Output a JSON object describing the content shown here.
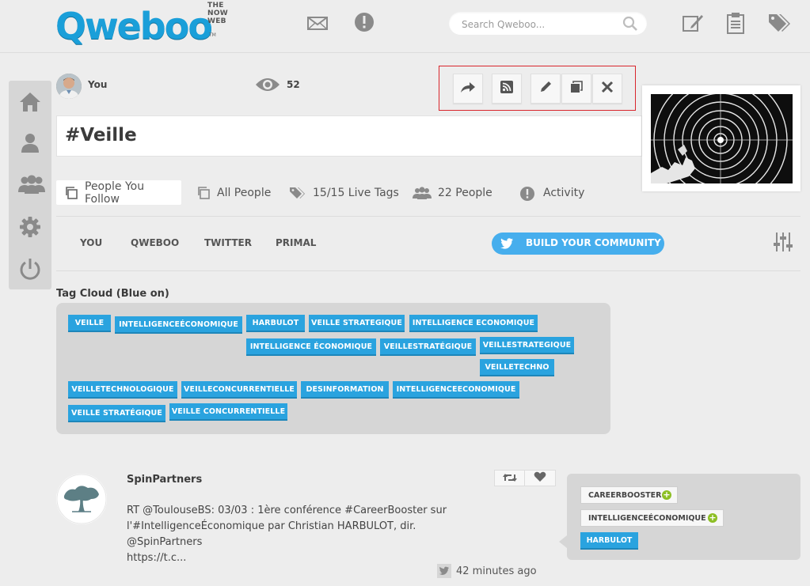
{
  "header": {
    "logo_word": "Qweboo",
    "logo_tagline": "THE NOW WEB",
    "logo_tm": "TM",
    "search_placeholder": "Search Qweboo..."
  },
  "profile": {
    "you_label": "You",
    "views": "52",
    "title": "#Veille"
  },
  "tabs": [
    {
      "label": "People You Follow",
      "active": true
    },
    {
      "label": "All People"
    },
    {
      "label": "15/15 Live Tags"
    },
    {
      "label": "22 People"
    },
    {
      "label": "Activity"
    }
  ],
  "subtabs": [
    "YOU",
    "QWEBOO",
    "TWITTER",
    "PRIMAL"
  ],
  "community_button": "BUILD YOUR COMMUNITY",
  "tag_cloud": {
    "title": "Tag Cloud (Blue on)",
    "tags": [
      "VEILLE",
      "INTELLIGENCEÉCONOMIQUE",
      "HARBULOT",
      "VEILLE STRATEGIQUE",
      "INTELLIGENCE ECONOMIQUE",
      "INTELLIGENCE ÉCONOMIQUE",
      "VEILLESTRATÉGIQUE",
      "VEILLESTRATEGIQUE",
      "VEILLETECHNO",
      "VEILLETECHNOLOGIQUE",
      "VEILLECONCURRENTIELLE",
      "DESINFORMATION",
      "INTELLIGENCEECONOMIQUE",
      "VEILLE STRATÉGIQUE",
      "VEILLE CONCURRENTIELLE"
    ]
  },
  "feed": {
    "author": "SpinPartners",
    "text_lines": [
      "RT @ToulouseBS: 03/03 : 1ère conférence #CareerBooster sur",
      "l'#IntelligenceÉconomique par Christian HARBULOT, dir. @SpinPartners",
      "https://t.c..."
    ],
    "tags": [
      "CAREERBOOSTER",
      "INTELLIGENCEÉCONOMIQUE",
      "HARBULOT"
    ],
    "plus_symbol": "+",
    "time": "42 minutes ago"
  },
  "colors": {
    "accent": "#2aa3df",
    "community": "#46aeed",
    "highlight_frame": "#d9262c",
    "plus_green": "#8dbf25"
  }
}
